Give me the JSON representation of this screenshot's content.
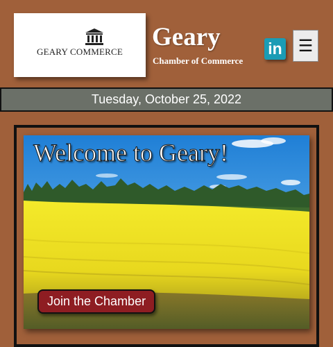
{
  "header": {
    "logo_text": "GEARY COMMERCE",
    "title": "Geary",
    "subtitle": "Chamber of Commerce",
    "linkedin_icon": "linkedin-icon",
    "linkedin_label": "in",
    "menu_icon": "hamburger-menu-icon",
    "menu_label": "☰"
  },
  "date_bar": {
    "text": "Tuesday, October 25, 2022"
  },
  "hero": {
    "heading": "Welcome to Geary!",
    "cta_label": "Join the Chamber",
    "image": "yellow-canola-field-landscape"
  },
  "colors": {
    "page_background": "#a0603a",
    "date_bar_background": "#6b7068",
    "linkedin": "#1a9cb5",
    "cta_background": "#8e1d22"
  }
}
